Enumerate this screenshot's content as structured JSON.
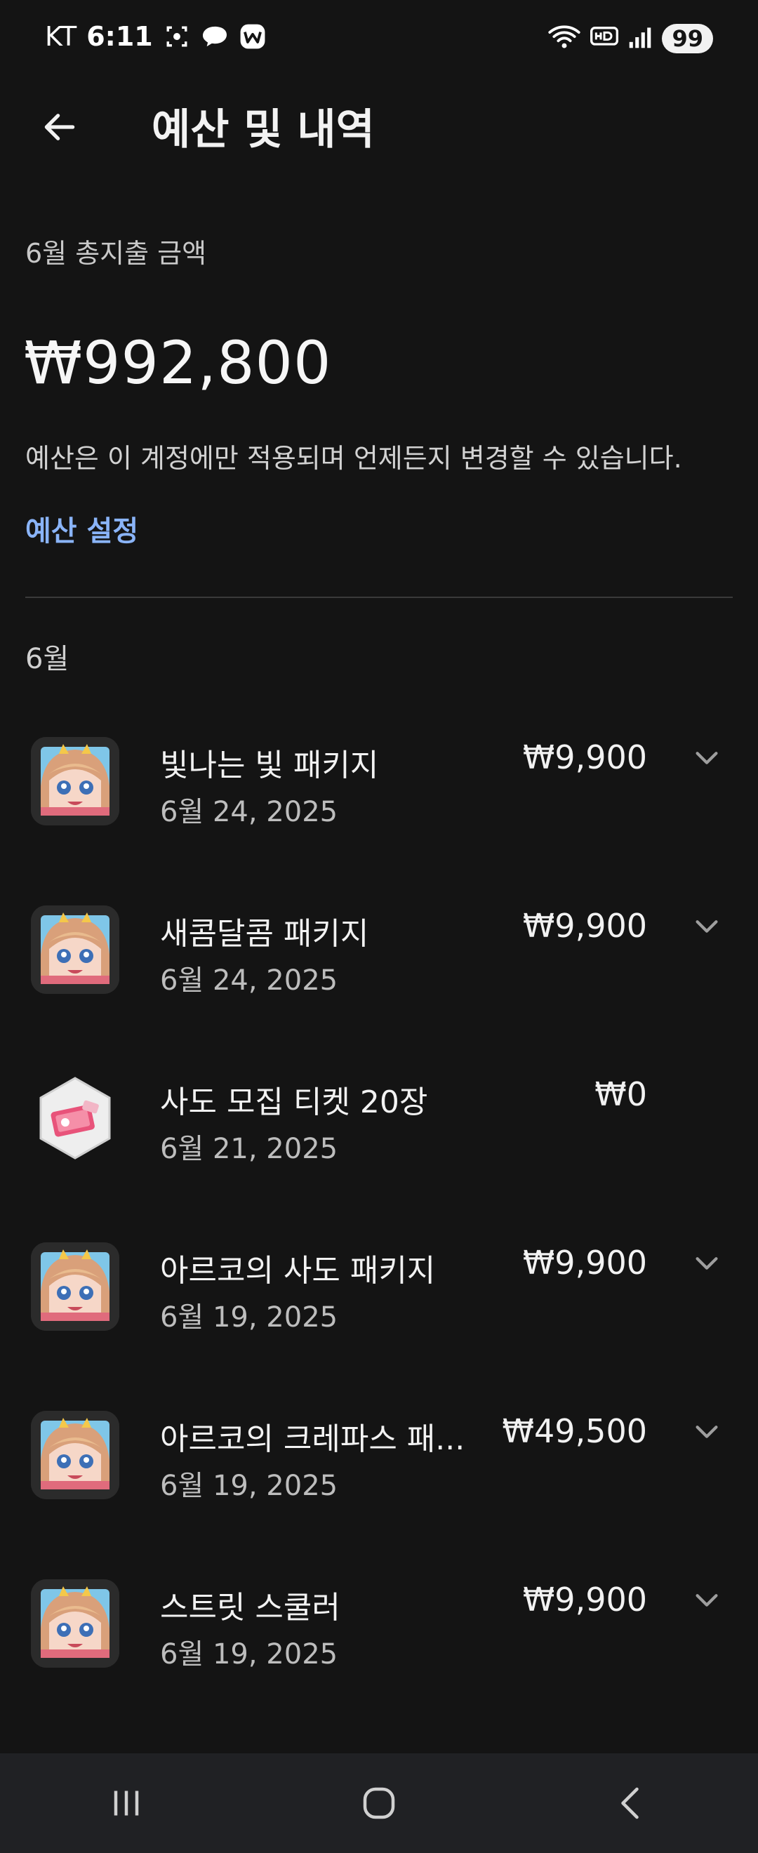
{
  "status_bar": {
    "carrier": "KT",
    "time": "6:11",
    "battery": "99"
  },
  "app_bar": {
    "title": "예산 및 내역"
  },
  "summary": {
    "total_label": "6월 총지출 금액",
    "total_amount": "₩992,800",
    "budget_note": "예산은 이 계정에만 적용되며 언제든지 변경할 수 있습니다.",
    "budget_link": "예산 설정"
  },
  "month_header": "6월",
  "transactions": [
    {
      "name": "빛나는 빛 패키지",
      "date": "6월 24, 2025",
      "price": "₩9,900",
      "icon": "anime-character-icon",
      "expandable": true
    },
    {
      "name": "새콤달콤 패키지",
      "date": "6월 24, 2025",
      "price": "₩9,900",
      "icon": "anime-character-icon",
      "expandable": true
    },
    {
      "name": "사도 모집 티켓 20장",
      "date": "6월 21, 2025",
      "price": "₩0",
      "icon": "ticket-hexagon-icon",
      "expandable": false
    },
    {
      "name": "아르코의 사도 패키지",
      "date": "6월 19, 2025",
      "price": "₩9,900",
      "icon": "anime-character-icon",
      "expandable": true
    },
    {
      "name": "아르코의 크레파스 패...",
      "date": "6월 19, 2025",
      "price": "₩49,500",
      "icon": "anime-character-icon",
      "expandable": true
    },
    {
      "name": "스트릿 스쿨러",
      "date": "6월 19, 2025",
      "price": "₩9,900",
      "icon": "anime-character-icon",
      "expandable": true
    }
  ],
  "colors": {
    "background": "#141414",
    "accent_link": "#8ab4f8",
    "nav_bar": "#202124"
  }
}
